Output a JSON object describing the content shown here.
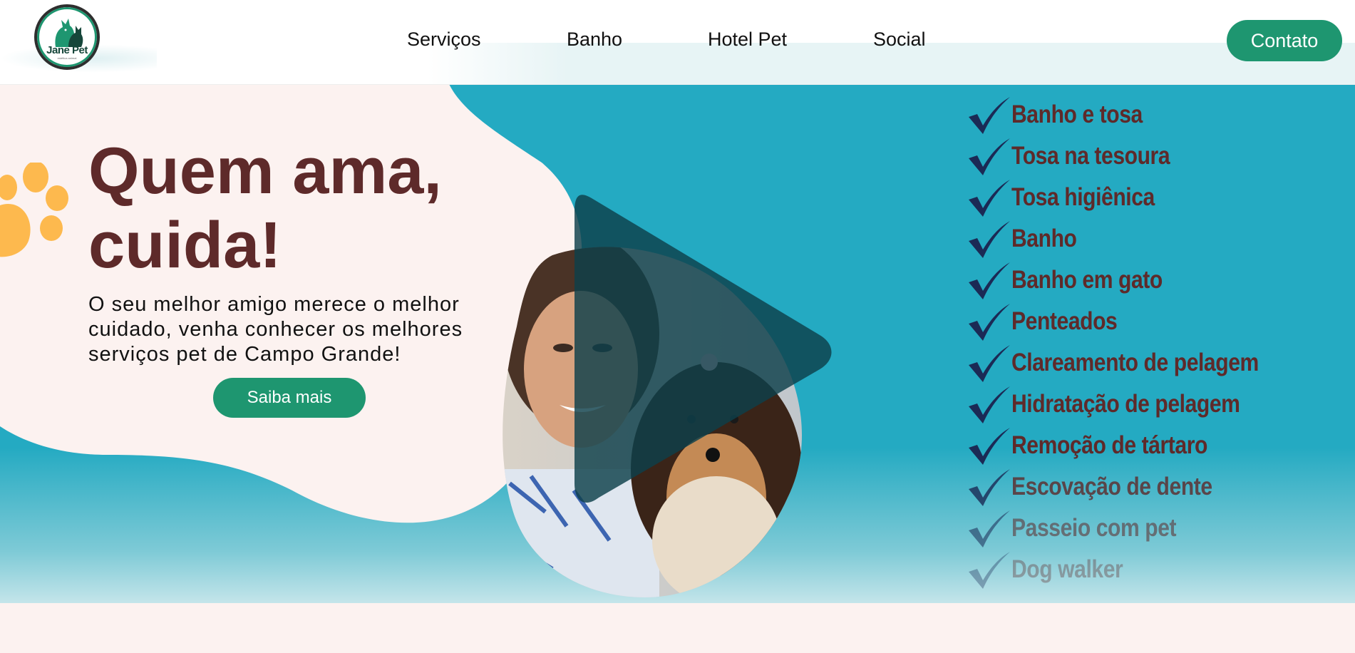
{
  "header": {
    "logo": {
      "name": "Jane Pet",
      "tagline": "estética animal"
    },
    "nav": [
      "Serviços",
      "Banho",
      "Hotel Pet",
      "Social"
    ],
    "contact_label": "Contato"
  },
  "hero": {
    "headline": "Quem ama, cuida!",
    "subtext": "O seu melhor amigo merece o melhor cuidado, venha conhecer os melhores serviços pet de Campo Grande!",
    "cta_label": "Saiba mais",
    "services": [
      "Banho e tosa",
      "Tosa na tesoura",
      "Tosa higiênica",
      "Banho",
      "Banho em gato",
      "Penteados",
      "Clareamento de pelagem",
      "Hidratação de pelagem",
      "Remoção de tártaro",
      "Escovação de dente",
      "Passeio com pet",
      "Dog walker"
    ]
  },
  "colors": {
    "brand_green": "#1e9670",
    "hero_teal": "#24aac2",
    "headline_maroon": "#5e2a2a",
    "blob_cream": "#fcf2f0",
    "paw_yellow": "#fdb94e",
    "check_navy": "#1b2a55"
  },
  "icons": [
    "logo-dog-cat-icon",
    "paw-icon",
    "play-icon",
    "checkmark-icon"
  ]
}
